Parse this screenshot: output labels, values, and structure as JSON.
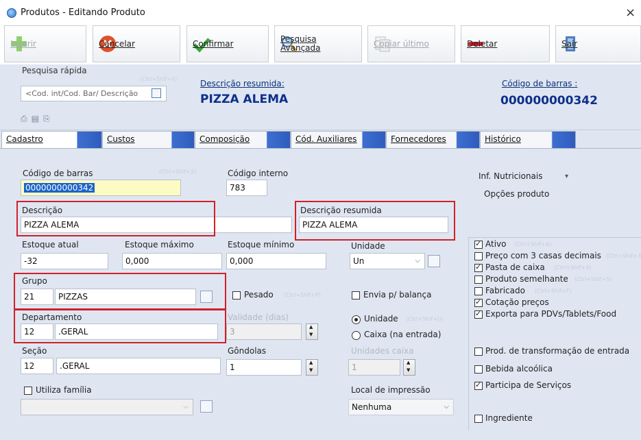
{
  "window": {
    "title": "Produtos - Editando Produto",
    "close": "×"
  },
  "toolbar": {
    "inserir": "Inserir",
    "cancelar": "Cancelar",
    "confirmar": "Confirmar",
    "pesquisa": "Pesquisa\nAvançada",
    "copiar": "Copiar último",
    "deletar": "Deletar",
    "sair": "Sair"
  },
  "header": {
    "quick_search_label": "Pesquisa rápida",
    "quick_search_hint": "(Ctrl+Shif+4)",
    "quick_search_placeholder": "<Cod. int/Cod. Bar/ Descrição",
    "desc_res_label": "Descrição resumida:",
    "desc_res_value": "PIZZA ALEMA",
    "barcode_label": "Código de barras :",
    "barcode_value": "000000000342"
  },
  "tabs": [
    "Cadastro",
    "Custos",
    "Composição",
    "Cód. Auxiliares",
    "Fornecedores",
    "Histórico"
  ],
  "form": {
    "barcode_label": "Código de barras",
    "barcode_hint": "(Ctrl+Shif+2)",
    "barcode_value": "0000000000342",
    "internal_code_label": "Código interno",
    "internal_code_value": "783",
    "nutri_label": "Inf. Nutricionais",
    "options_label": "Opções produto",
    "description_label": "Descrição",
    "description_value": "PIZZA ALEMA",
    "desc_res_label": "Descrição resumida",
    "desc_res_value": "PIZZA ALEMA",
    "stock_label": "Estoque atual",
    "stock_value": "-32",
    "stock_max_label": "Estoque máximo",
    "stock_max_value": "0,000",
    "stock_min_label": "Estoque mínimo",
    "stock_min_value": "0,000",
    "unit_label": "Unidade",
    "unit_value": "Un",
    "group_label": "Grupo",
    "group_code": "21",
    "group_name": "PIZZAS",
    "weighed_label": "Pesado",
    "weighed_hint": "(Ctrl+Shif+P)",
    "scale_label": "Envia p/ balança",
    "dept_label": "Departamento",
    "dept_code": "12",
    "dept_name": ".GERAL",
    "validity_label": "Validade (dias)",
    "validity_value": "3",
    "radio_unit": "Unidade",
    "radio_unit_hint": "(Ctrl+Shif+U)",
    "radio_box": "Caixa (na entrada)",
    "section_label": "Seção",
    "section_code": "12",
    "section_name": ".GERAL",
    "gondolas_label": "Gôndolas",
    "gondolas_value": "1",
    "units_box_label": "Unidades caixa",
    "units_box_value": "1",
    "family_label": "Utiliza família",
    "print_label": "Local de impressão",
    "print_value": "Nenhuma"
  },
  "options": [
    {
      "label": "Ativo",
      "hint": "(Ctrl+Shif+A)",
      "checked": true
    },
    {
      "label": "Preço com 3 casas decimais",
      "hint": "(Ctrl+Shif+3)",
      "checked": false
    },
    {
      "label": "Pasta de caixa",
      "hint": "(Ctrl+Shif+X)",
      "checked": true
    },
    {
      "label": "Produto semelhante",
      "hint": "(Ctrl+Shif+S)",
      "checked": false
    },
    {
      "label": "Fabricado",
      "hint": "(Ctrl+Shif+F)",
      "checked": false
    },
    {
      "label": "Cotação preços",
      "hint": "",
      "checked": true
    },
    {
      "label": "Exporta para PDVs/Tablets/Food",
      "hint": "",
      "checked": true
    },
    {
      "label": "Prod. de transformação de entrada",
      "hint": "",
      "checked": false
    },
    {
      "label": "Bebida alcoólica",
      "hint": "",
      "checked": false
    },
    {
      "label": "Participa de Serviços",
      "hint": "",
      "checked": true
    },
    {
      "label": "Ingrediente",
      "hint": "",
      "checked": false
    }
  ],
  "colors": {
    "accent_red": "#d0202a",
    "title_blue": "#0d2f8c",
    "panel_bg": "#dfe6f1",
    "tab_blue": "#2f5cbd"
  }
}
